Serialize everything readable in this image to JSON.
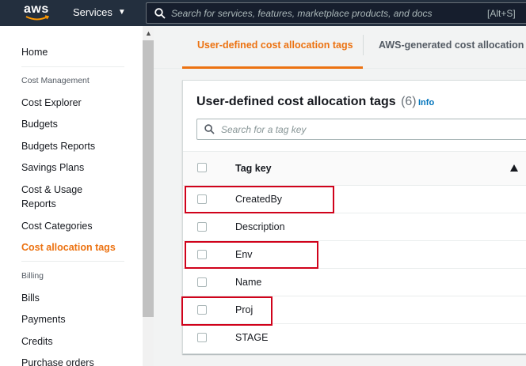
{
  "nav": {
    "logo": "aws",
    "services_label": "Services",
    "search_placeholder": "Search for services, features, marketplace products, and docs",
    "search_shortcut": "[Alt+S]"
  },
  "sidebar": {
    "home": "Home",
    "section_cost_management": "Cost Management",
    "items": [
      "Cost Explorer",
      "Budgets",
      "Budgets Reports",
      "Savings Plans"
    ],
    "cost_usage_line1": "Cost & Usage",
    "cost_usage_line2": "Reports",
    "cost_categories": "Cost Categories",
    "active_item": "Cost allocation tags",
    "section_billing": "Billing",
    "billing_items": [
      "Bills",
      "Payments",
      "Credits",
      "Purchase orders"
    ]
  },
  "tabs": {
    "user_defined": "User-defined cost allocation tags",
    "aws_generated": "AWS-generated cost allocation t"
  },
  "card": {
    "title": "User-defined cost allocation tags",
    "count": "(6)",
    "info_link": "Info",
    "filter_placeholder": "Search for a tag key",
    "column_header": "Tag key",
    "rows": [
      "CreatedBy",
      "Description",
      "Env",
      "Name",
      "Proj",
      "STAGE"
    ]
  },
  "colors": {
    "accent_orange": "#ec7211",
    "nav_bg": "#232f3e",
    "link_blue": "#0073bb",
    "highlight_red": "#d0021b"
  }
}
